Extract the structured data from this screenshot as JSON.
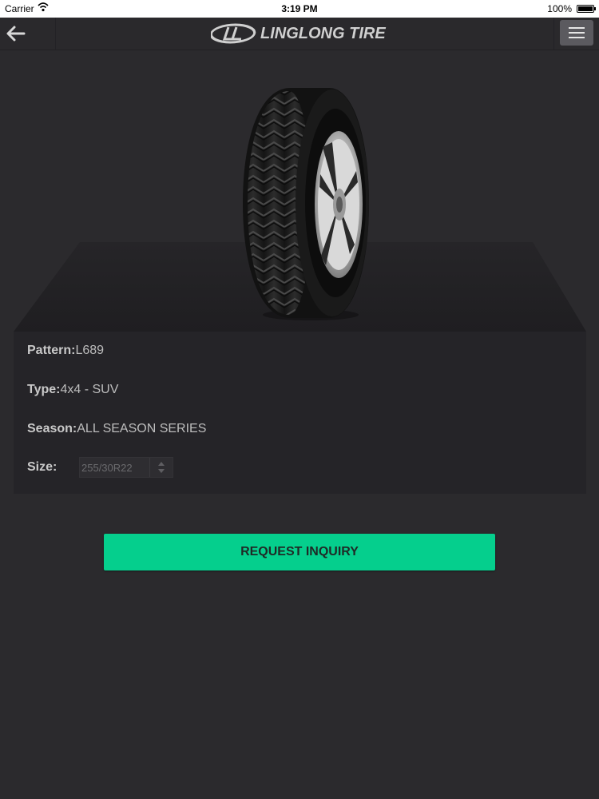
{
  "status_bar": {
    "carrier": "Carrier",
    "time": "3:19 PM",
    "battery": "100%"
  },
  "nav": {
    "brand": "LINGLONG TIRE",
    "back_icon": "arrow-left-icon",
    "menu_icon": "hamburger-menu-icon"
  },
  "product": {
    "pattern_label": "Pattern:",
    "pattern_value": "L689",
    "type_label": "Type:",
    "type_value": "4x4 - SUV",
    "season_label": "Season:",
    "season_value": "ALL SEASON SERIES",
    "size_label": "Size:",
    "size_value": "255/30R22"
  },
  "actions": {
    "inquiry_label": "REQUEST INQUIRY"
  },
  "colors": {
    "background": "#2b2a2d",
    "accent": "#05cf8d",
    "panel": "#252428"
  }
}
